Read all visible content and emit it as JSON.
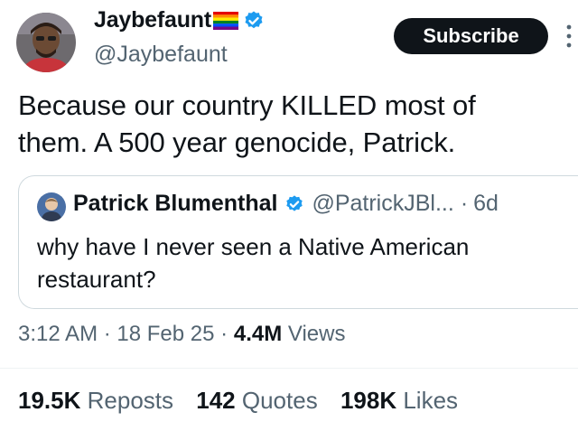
{
  "author": {
    "display_name": "Jaybefaunt",
    "handle": "@Jaybefaunt"
  },
  "subscribe_label": "Subscribe",
  "tweet": {
    "text_line1": "Because our country KILLED most of",
    "text_line2": "them. A 500 year genocide, Patrick."
  },
  "quoted": {
    "name": "Patrick Blumenthal",
    "handle": "@PatrickJBl...",
    "separator": "·",
    "age": "6d",
    "text_line1": "why have I never seen a Native American",
    "text_line2": "restaurant?"
  },
  "meta": {
    "time": "3:12 AM",
    "sep1": "·",
    "date": "18 Feb 25",
    "sep2": "·",
    "views_count": "4.4M",
    "views_label": "Views"
  },
  "stats": {
    "reposts_count": "19.5K",
    "reposts_label": "Reposts",
    "quotes_count": "142",
    "quotes_label": "Quotes",
    "likes_count": "198K",
    "likes_label": "Likes"
  },
  "colors": {
    "verified": "#1d9bf0",
    "muted": "#536471",
    "text": "#0f1419",
    "border": "#cfd9de"
  },
  "icons": [
    "avatar",
    "rainbow-flag-icon",
    "verified-badge-icon",
    "more-icon"
  ]
}
